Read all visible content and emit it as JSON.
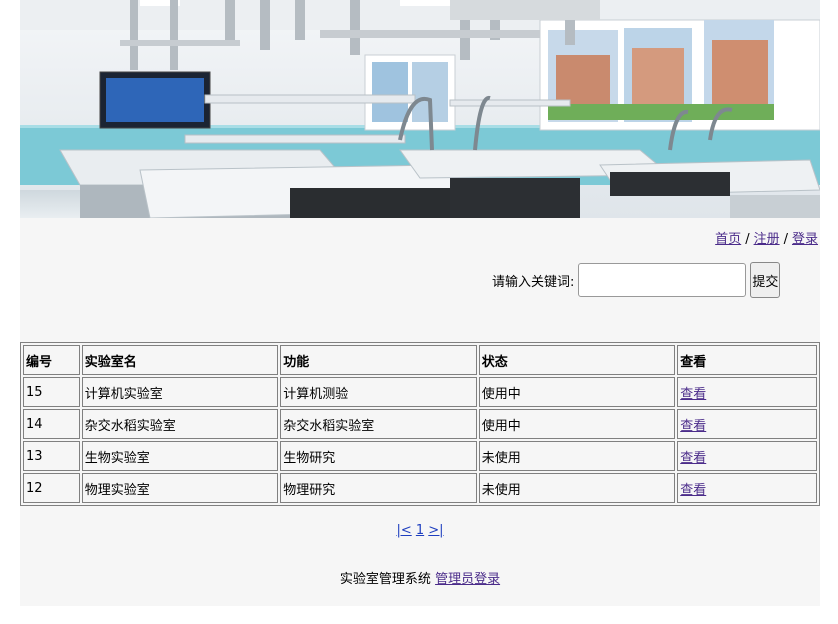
{
  "nav": {
    "home": "首页",
    "register": "注册",
    "login": "登录",
    "separator": "/"
  },
  "search": {
    "label": "请输入关键词:",
    "value": "",
    "submit": "提交"
  },
  "table": {
    "headers": [
      "编号",
      "实验室名",
      "功能",
      "状态",
      "查看"
    ],
    "rows": [
      {
        "id": "15",
        "name": "计算机实验室",
        "function": "计算机测验",
        "status": "使用中",
        "view": "查看"
      },
      {
        "id": "14",
        "name": "杂交水稻实验室",
        "function": "杂交水稻实验室",
        "status": "使用中",
        "view": "查看"
      },
      {
        "id": "13",
        "name": "生物实验室",
        "function": "生物研究",
        "status": "未使用",
        "view": "查看"
      },
      {
        "id": "12",
        "name": "物理实验室",
        "function": "物理研究",
        "status": "未使用",
        "view": "查看"
      }
    ]
  },
  "pager": {
    "prev": "|<",
    "current": "1",
    "next": ">|"
  },
  "footer": {
    "text": "实验室管理系统",
    "admin_link": "管理员登录"
  },
  "colors": {
    "page_bg": "#f6f6f6",
    "link_visited": "#4b2c8a",
    "link": "#1f3fbf",
    "border": "#808080"
  }
}
